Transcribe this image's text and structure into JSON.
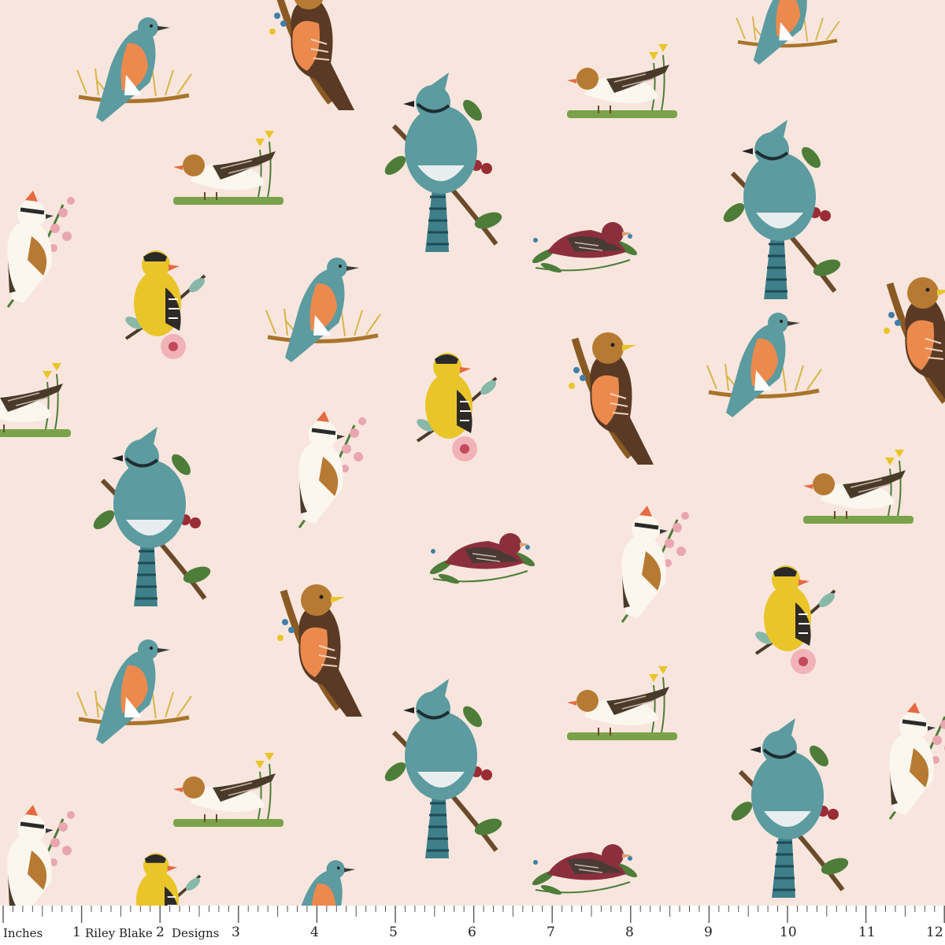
{
  "fabric": {
    "background": "#f8e6de",
    "motifs": [
      {
        "species": "bluebird",
        "icon": "bluebird-icon"
      },
      {
        "species": "blue-jay",
        "icon": "blue-jay-icon"
      },
      {
        "species": "goldfinch",
        "icon": "goldfinch-icon"
      },
      {
        "species": "robin",
        "icon": "robin-icon"
      },
      {
        "species": "purple-finch",
        "icon": "purple-finch-icon"
      },
      {
        "species": "waxwing",
        "icon": "waxwing-icon"
      },
      {
        "species": "wren-in-grass",
        "icon": "wren-icon"
      }
    ],
    "palette": {
      "teal": "#5c9ba0",
      "orange": "#ec8a4e",
      "yellow": "#e9c52a",
      "brown": "#8a5a24",
      "plum": "#8c2f3d",
      "leaf": "#4e7d3a",
      "pink": "#e9a6ae",
      "cream": "#fbf6ee"
    }
  },
  "ruler": {
    "unit_label": "Inches",
    "brand_part1": "Riley Blake",
    "brand_part2": "Designs",
    "numbers": [
      "1",
      "2",
      "3",
      "4",
      "5",
      "6",
      "7",
      "8",
      "9",
      "10",
      "11",
      "12"
    ]
  }
}
